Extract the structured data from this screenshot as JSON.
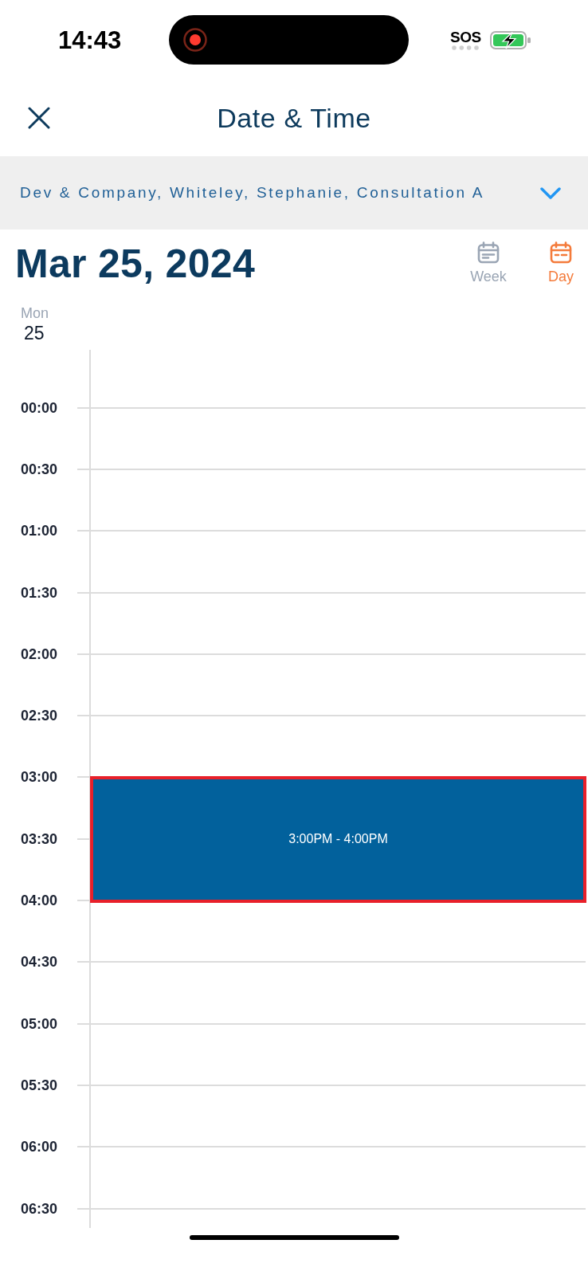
{
  "status_bar": {
    "time": "14:43",
    "carrier": "SOS"
  },
  "header": {
    "title": "Date & Time"
  },
  "filter": {
    "value": "Dev & Company, Whiteley, Stephanie, Consultation A"
  },
  "date_heading": "Mar 25, 2024",
  "views": [
    {
      "kind": "week",
      "label": "Week",
      "selected": false
    },
    {
      "kind": "day",
      "label": "Day",
      "selected": true
    }
  ],
  "day_column": {
    "weekday": "Mon",
    "day": "25"
  },
  "slots": [
    {
      "time": "00:00"
    },
    {
      "time": "00:30"
    },
    {
      "time": "01:00"
    },
    {
      "time": "01:30"
    },
    {
      "time": "02:00"
    },
    {
      "time": "02:30"
    },
    {
      "time": "03:00",
      "event": {
        "label": "3:00PM - 4:00PM",
        "selected": true
      }
    },
    {
      "time": "03:30"
    },
    {
      "time": "04:00"
    },
    {
      "time": "04:30"
    },
    {
      "time": "05:00"
    },
    {
      "time": "05:30"
    },
    {
      "time": "06:00"
    },
    {
      "time": "06:30"
    }
  ]
}
